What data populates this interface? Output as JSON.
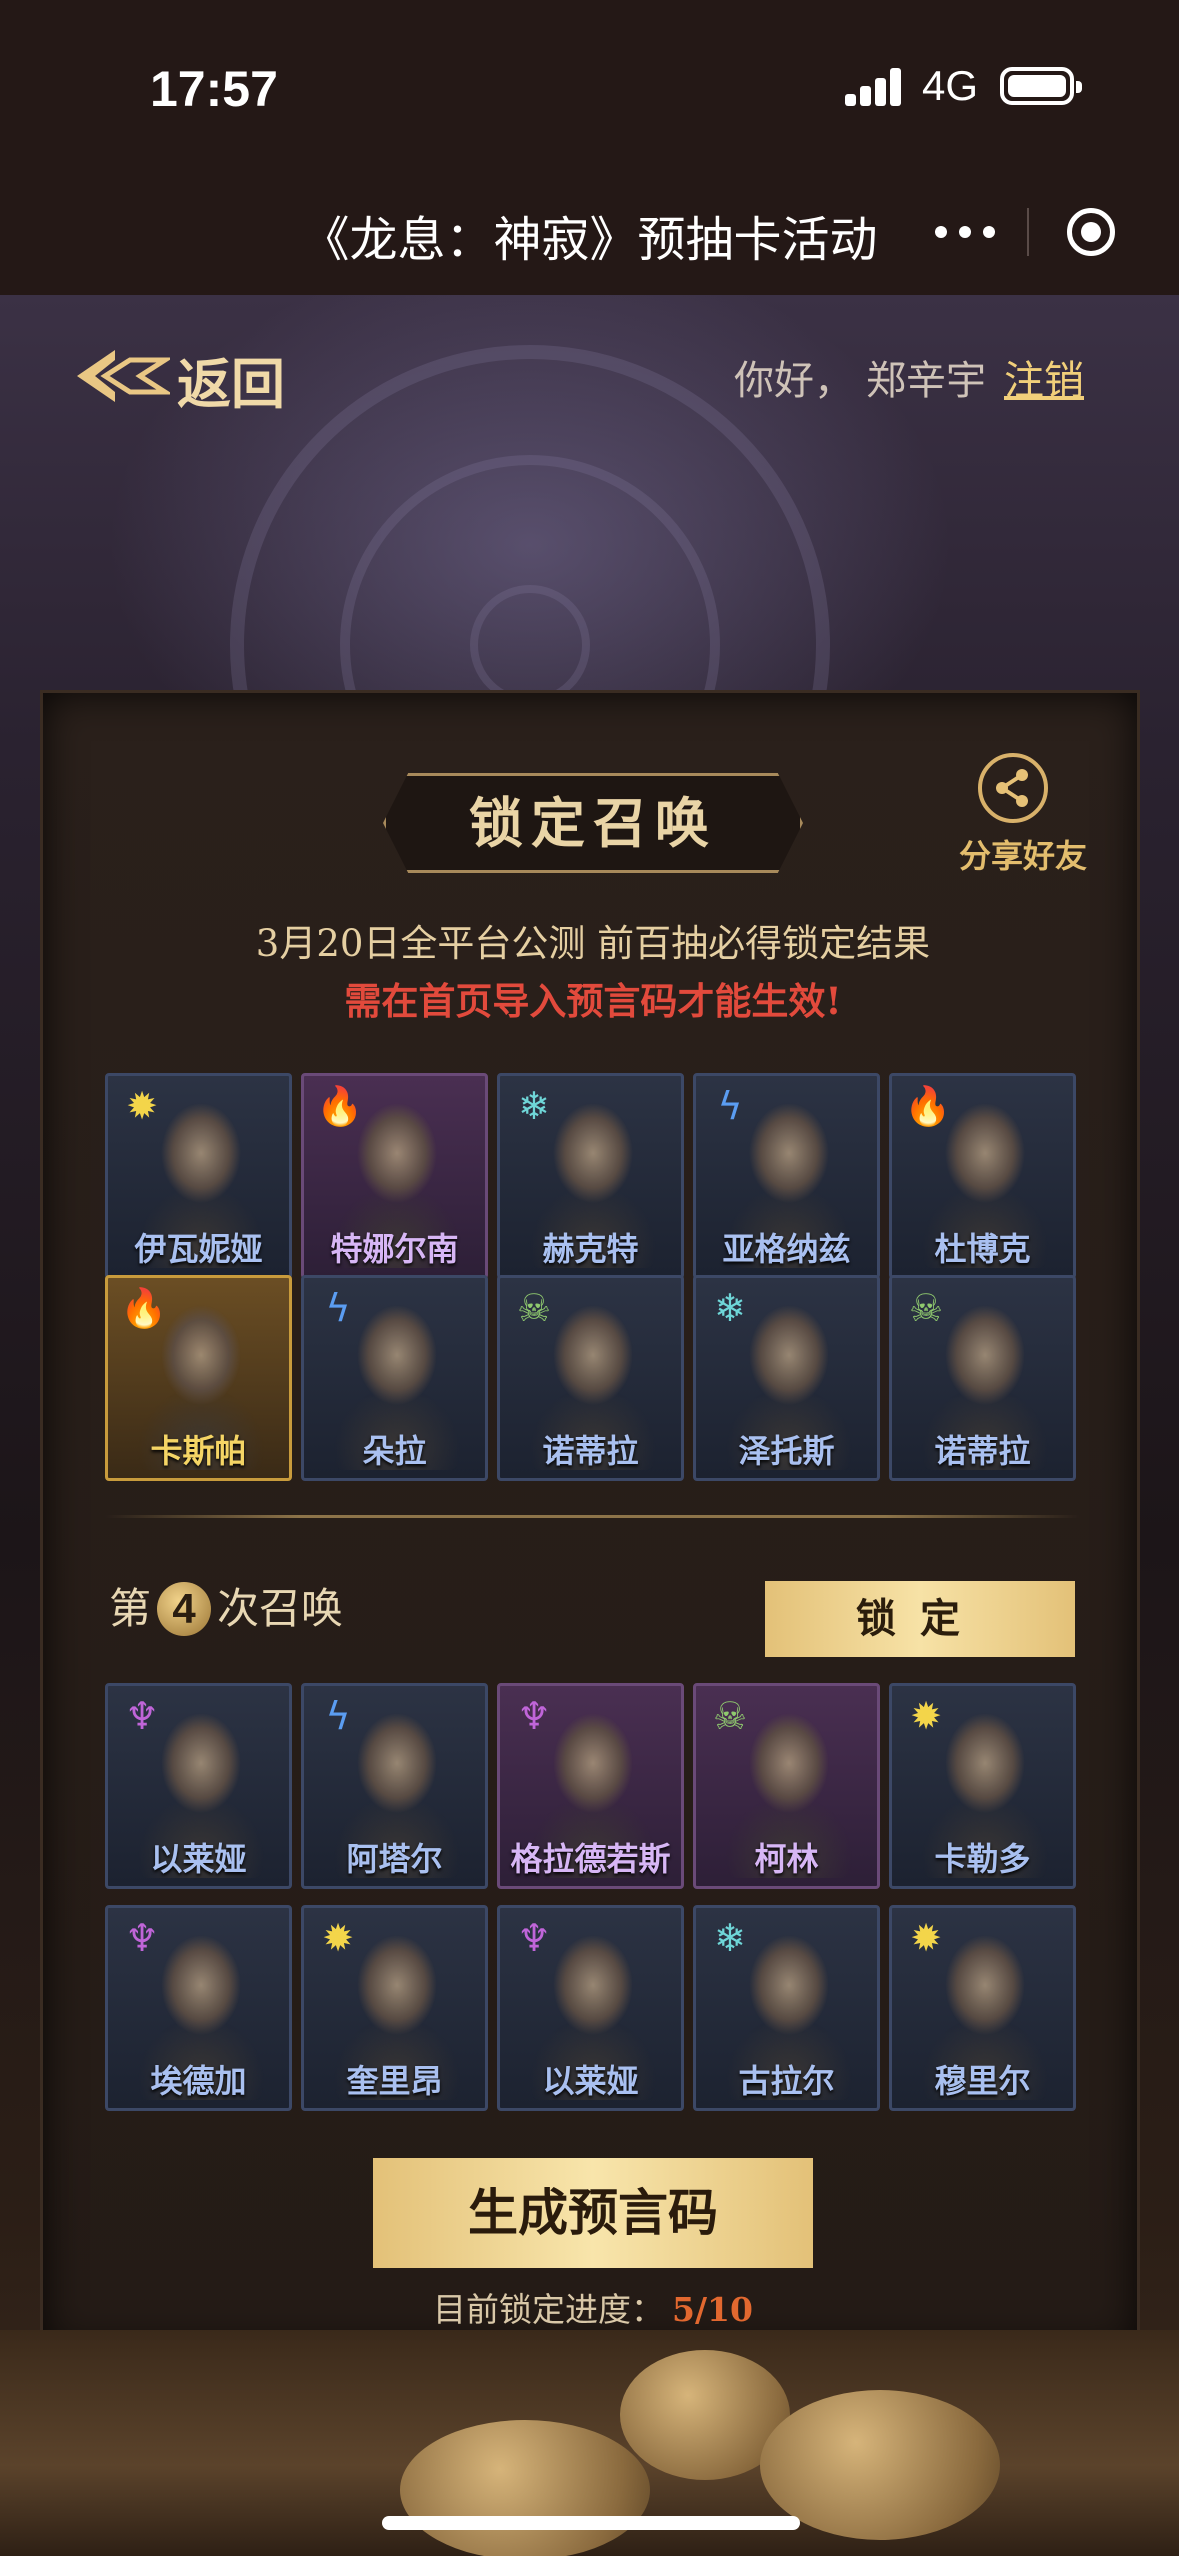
{
  "status": {
    "time": "17:57",
    "network": "4G"
  },
  "window": {
    "title": "《龙息：神寂》预抽卡活动"
  },
  "header": {
    "back_label": "返回",
    "greeting": "你好，",
    "user": "郑辛宇",
    "logout": "注销"
  },
  "panel": {
    "title": "锁定召唤",
    "share_label": "分享好友",
    "notice_line1": "3月20日全平台公测 前百抽必得锁定结果",
    "notice_line2": "需在首页导入预言码才能生效!",
    "previous_rows": [
      [
        {
          "name": "伊瓦妮娅",
          "element": "sun",
          "style": "blue"
        },
        {
          "name": "特娜尔南",
          "element": "fire",
          "style": "purple"
        },
        {
          "name": "赫克特",
          "element": "frost",
          "style": "blue"
        },
        {
          "name": "亚格纳兹",
          "element": "bolt",
          "style": "blue"
        },
        {
          "name": "杜博克",
          "element": "fire",
          "style": "blue"
        }
      ],
      [
        {
          "name": "卡斯帕",
          "element": "fire",
          "style": "gold"
        },
        {
          "name": "朵拉",
          "element": "bolt",
          "style": "blue"
        },
        {
          "name": "诺蒂拉",
          "element": "skull",
          "style": "blue"
        },
        {
          "name": "泽托斯",
          "element": "frost",
          "style": "blue"
        },
        {
          "name": "诺蒂拉",
          "element": "skull",
          "style": "blue"
        }
      ]
    ],
    "round": {
      "prefix": "第",
      "number": "4",
      "suffix": "次召唤",
      "lock_button": "锁定"
    },
    "current_rows": [
      [
        {
          "name": "以莱娅",
          "element": "demon",
          "style": "blue"
        },
        {
          "name": "阿塔尔",
          "element": "bolt",
          "style": "blue"
        },
        {
          "name": "格拉德若斯",
          "element": "demon",
          "style": "purple"
        },
        {
          "name": "柯林",
          "element": "skull",
          "style": "purple"
        },
        {
          "name": "卡勒多",
          "element": "sun",
          "style": "blue"
        }
      ],
      [
        {
          "name": "埃德加",
          "element": "demon",
          "style": "blue"
        },
        {
          "name": "奎里昂",
          "element": "sun",
          "style": "blue"
        },
        {
          "name": "以莱娅",
          "element": "demon",
          "style": "blue"
        },
        {
          "name": "古拉尔",
          "element": "frost",
          "style": "blue"
        },
        {
          "name": "穆里尔",
          "element": "sun",
          "style": "blue"
        }
      ]
    ],
    "generate_button": "生成预言码",
    "progress_label": "目前锁定进度：",
    "progress_value": "5/10"
  },
  "icons": {
    "sun": "✹",
    "fire": "🔥",
    "frost": "❄",
    "bolt": "ϟ",
    "skull": "☠",
    "demon": "♆"
  }
}
